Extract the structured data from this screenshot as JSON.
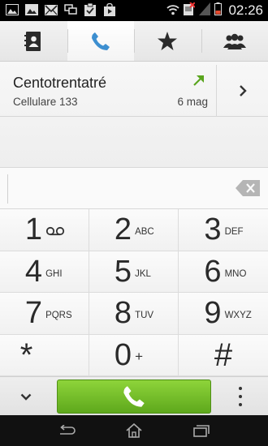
{
  "status_bar": {
    "time": "02:26",
    "left_icons": [
      "image-icon",
      "gallery-icon",
      "mail-icon",
      "screens-icon",
      "clipboard-check-icon",
      "store-bag-icon"
    ],
    "right_icons": [
      "wifi-icon",
      "sim-off-icon",
      "signal-icon",
      "battery-low-icon"
    ],
    "battery_color": "#e84b2e"
  },
  "tabs": [
    {
      "name": "contacts",
      "icon": "contacts-book-icon",
      "active": false
    },
    {
      "name": "phone",
      "icon": "phone-icon",
      "active": true
    },
    {
      "name": "favorites",
      "icon": "star-icon",
      "active": false
    },
    {
      "name": "groups",
      "icon": "people-icon",
      "active": false
    }
  ],
  "recent_call": {
    "name": "Centotrentatré",
    "subtitle": "Cellulare 133",
    "date": "6 mag",
    "direction_icon": "outgoing-arrow-icon",
    "arrow_color": "#5aa51e"
  },
  "number_entry": {
    "value": "",
    "placeholder": ""
  },
  "keypad": [
    {
      "digit": "1",
      "letters": "",
      "icon": "voicemail-icon"
    },
    {
      "digit": "2",
      "letters": "ABC"
    },
    {
      "digit": "3",
      "letters": "DEF"
    },
    {
      "digit": "4",
      "letters": "GHI"
    },
    {
      "digit": "5",
      "letters": "JKL"
    },
    {
      "digit": "6",
      "letters": "MNO"
    },
    {
      "digit": "7",
      "letters": "PQRS"
    },
    {
      "digit": "8",
      "letters": "TUV"
    },
    {
      "digit": "9",
      "letters": "WXYZ"
    },
    {
      "digit": "*",
      "letters": ""
    },
    {
      "digit": "0",
      "letters": "+"
    },
    {
      "digit": "#",
      "letters": ""
    }
  ],
  "colors": {
    "accent_blue": "#3d8fd0",
    "call_green": "#6cb82a"
  }
}
